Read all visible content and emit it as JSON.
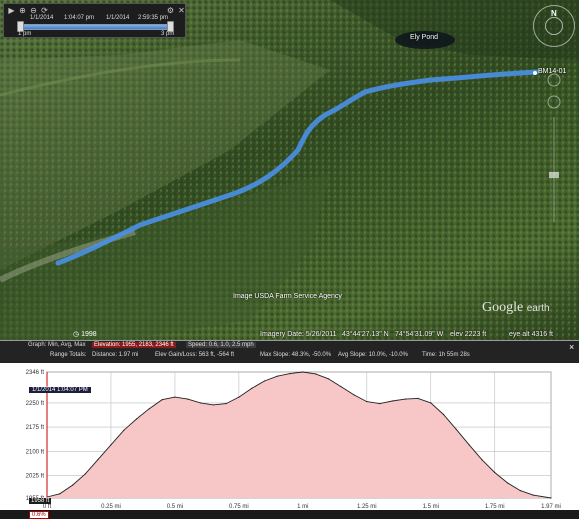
{
  "time_panel": {
    "start_label": "1/1/2014",
    "start_time": "1:04:07 pm",
    "end_label": "1/1/2014",
    "end_time": "2:59:35 pm",
    "left_tick": "1 pm",
    "right_tick": "3 pm",
    "icons": [
      "play-icon",
      "zoom-in-icon",
      "zoom-out-icon",
      "repeat-icon",
      "settings-icon",
      "close-icon"
    ]
  },
  "map": {
    "pond_label": "Ely Pond",
    "waypoint_label": "BM14-01",
    "imagery_credit": "Image USDA Farm Service Agency",
    "year_badge": "1998",
    "logo": "Google",
    "logo_suffix": "earth",
    "compass_letter": "N",
    "colors": {
      "track": "#4a90e6",
      "forest_dark": "#2f4a22",
      "forest_light": "#5d7a45"
    }
  },
  "status": {
    "imagery_date": "Imagery Date: 5/26/2011",
    "lat": "43°44'27.13\" N",
    "lon": "74°54'31.09\" W",
    "elev": "elev 2223 ft",
    "eye_alt": "eye alt 4316 ft"
  },
  "elevation_panel": {
    "graph_label": "Graph: Min, Avg, Max",
    "elevation_values": "Elevation: 1955, 2183, 2346 ft",
    "speed_values": "Speed: 0.6, 1.0, 2.5 mph",
    "range_totals_label": "Range Totals:",
    "distance": "Distance: 1.97 mi",
    "gain_loss": "Elev Gain/Loss: 563 ft, -564 ft",
    "max_slope": "Max Slope: 48.3%, -50.0%",
    "avg_slope": "Avg Slope: 10.0%, -10.0%",
    "time": "Time: 1h 55m 28s",
    "cursor_time": "1/1/2014 1:04:07 PM",
    "cursor_elev": "1958 ft",
    "cursor_grade": "0.6%",
    "close_glyph": "×"
  },
  "chart_data": {
    "type": "area",
    "title": "",
    "xlabel": "",
    "ylabel": "",
    "ylim": [
      1955,
      2346
    ],
    "xlim": [
      0,
      1.97
    ],
    "y_ticks": [
      "2346 ft",
      "2250 ft",
      "2175 ft",
      "2100 ft",
      "2025 ft",
      "1955 ft"
    ],
    "y_tick_values": [
      2346,
      2250,
      2175,
      2100,
      2025,
      1955
    ],
    "x_ticks": [
      "0 ft",
      "0.25 mi",
      "0.5 mi",
      "0.75 mi",
      "1 mi",
      "1.25 mi",
      "1.5 mi",
      "1.75 mi",
      "1.97 mi"
    ],
    "x_tick_values": [
      0,
      0.25,
      0.5,
      0.75,
      1.0,
      1.25,
      1.5,
      1.75,
      1.97
    ],
    "x": [
      0,
      0.05,
      0.1,
      0.15,
      0.2,
      0.25,
      0.3,
      0.35,
      0.4,
      0.45,
      0.5,
      0.55,
      0.6,
      0.65,
      0.7,
      0.75,
      0.8,
      0.85,
      0.9,
      0.95,
      1.0,
      1.05,
      1.1,
      1.15,
      1.2,
      1.25,
      1.3,
      1.35,
      1.4,
      1.45,
      1.5,
      1.55,
      1.6,
      1.65,
      1.7,
      1.75,
      1.8,
      1.85,
      1.9,
      1.97
    ],
    "y": [
      1958,
      1968,
      1995,
      2030,
      2075,
      2120,
      2165,
      2200,
      2232,
      2260,
      2268,
      2262,
      2250,
      2244,
      2248,
      2268,
      2295,
      2318,
      2333,
      2341,
      2346,
      2340,
      2325,
      2300,
      2275,
      2254,
      2248,
      2256,
      2262,
      2264,
      2250,
      2214,
      2168,
      2120,
      2074,
      2034,
      2002,
      1978,
      1964,
      1955
    ],
    "colors": {
      "fill": "#f7c7c7",
      "line": "#222222",
      "grid": "#bdbdbd"
    }
  }
}
